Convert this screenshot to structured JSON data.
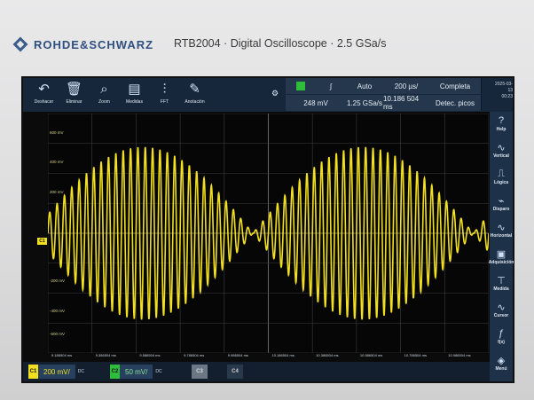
{
  "brand": {
    "name": "ROHDE&SCHWARZ",
    "product": "RTB2004 · Digital Oscilloscope · 2.5 GSa/s"
  },
  "colors": {
    "trace": "#f2e020",
    "toolbar": "#16273c",
    "accent": "#6fb3ea"
  },
  "toolbar": [
    {
      "icon": "undo-icon",
      "label": "Deshacer"
    },
    {
      "icon": "trash-icon",
      "label": "Eliminar"
    },
    {
      "icon": "zoom-icon",
      "label": "Zoom"
    },
    {
      "icon": "meter-icon",
      "label": "Medidas"
    },
    {
      "icon": "fft-icon",
      "label": "FFT"
    },
    {
      "icon": "pen-icon",
      "label": "Anotación"
    }
  ],
  "status": {
    "trigger_level": "248 mV",
    "trigger_mode": "Auto",
    "sample_rate": "1.25 GSa/s",
    "time_scale": "200 µs/",
    "time_position": "10.186 504 ms",
    "acq_state": "Completa",
    "acq_mode": "Detec. picos",
    "date": "2025-03-13",
    "time": "00:23"
  },
  "y_labels": [
    "200 mV",
    "400 mV",
    "600 mV",
    "-200 mV",
    "-400 mV",
    "-600 mV"
  ],
  "x_labels": [
    "9.186504 ms",
    "9.386504 ms",
    "9.586504 ms",
    "9.786504 ms",
    "9.986504 ms",
    "10.186504 ms",
    "10.386504 ms",
    "10.586504 ms",
    "10.786504 ms",
    "10.986504 ms"
  ],
  "sidebar": [
    {
      "icon": "help-icon",
      "label": "Help"
    },
    {
      "icon": "vertical-icon",
      "label": "Vertical"
    },
    {
      "icon": "logic-icon",
      "label": "Lógica"
    },
    {
      "icon": "trigger-icon",
      "label": "Disparo"
    },
    {
      "icon": "horizontal-icon",
      "label": "Horizontal"
    },
    {
      "icon": "acquisition-icon",
      "label": "Adquisición"
    },
    {
      "icon": "measure-icon",
      "label": "Medida"
    },
    {
      "icon": "cursor-icon",
      "label": "Cursor"
    },
    {
      "icon": "function-icon",
      "label": "f(x)"
    },
    {
      "icon": "menu-icon",
      "label": "Menú"
    }
  ],
  "channels": [
    {
      "tag": "C1",
      "scale": "200 mV/",
      "coupling": "DC"
    },
    {
      "tag": "C2",
      "scale": "50 mV/",
      "coupling": "DC"
    },
    {
      "tag": "C3",
      "scale": "",
      "coupling": ""
    },
    {
      "tag": "C4",
      "scale": "",
      "coupling": ""
    }
  ],
  "waveform": {
    "carrier_cycles": 60,
    "envelope_periods": 2,
    "amplitude_fraction": 0.72
  }
}
